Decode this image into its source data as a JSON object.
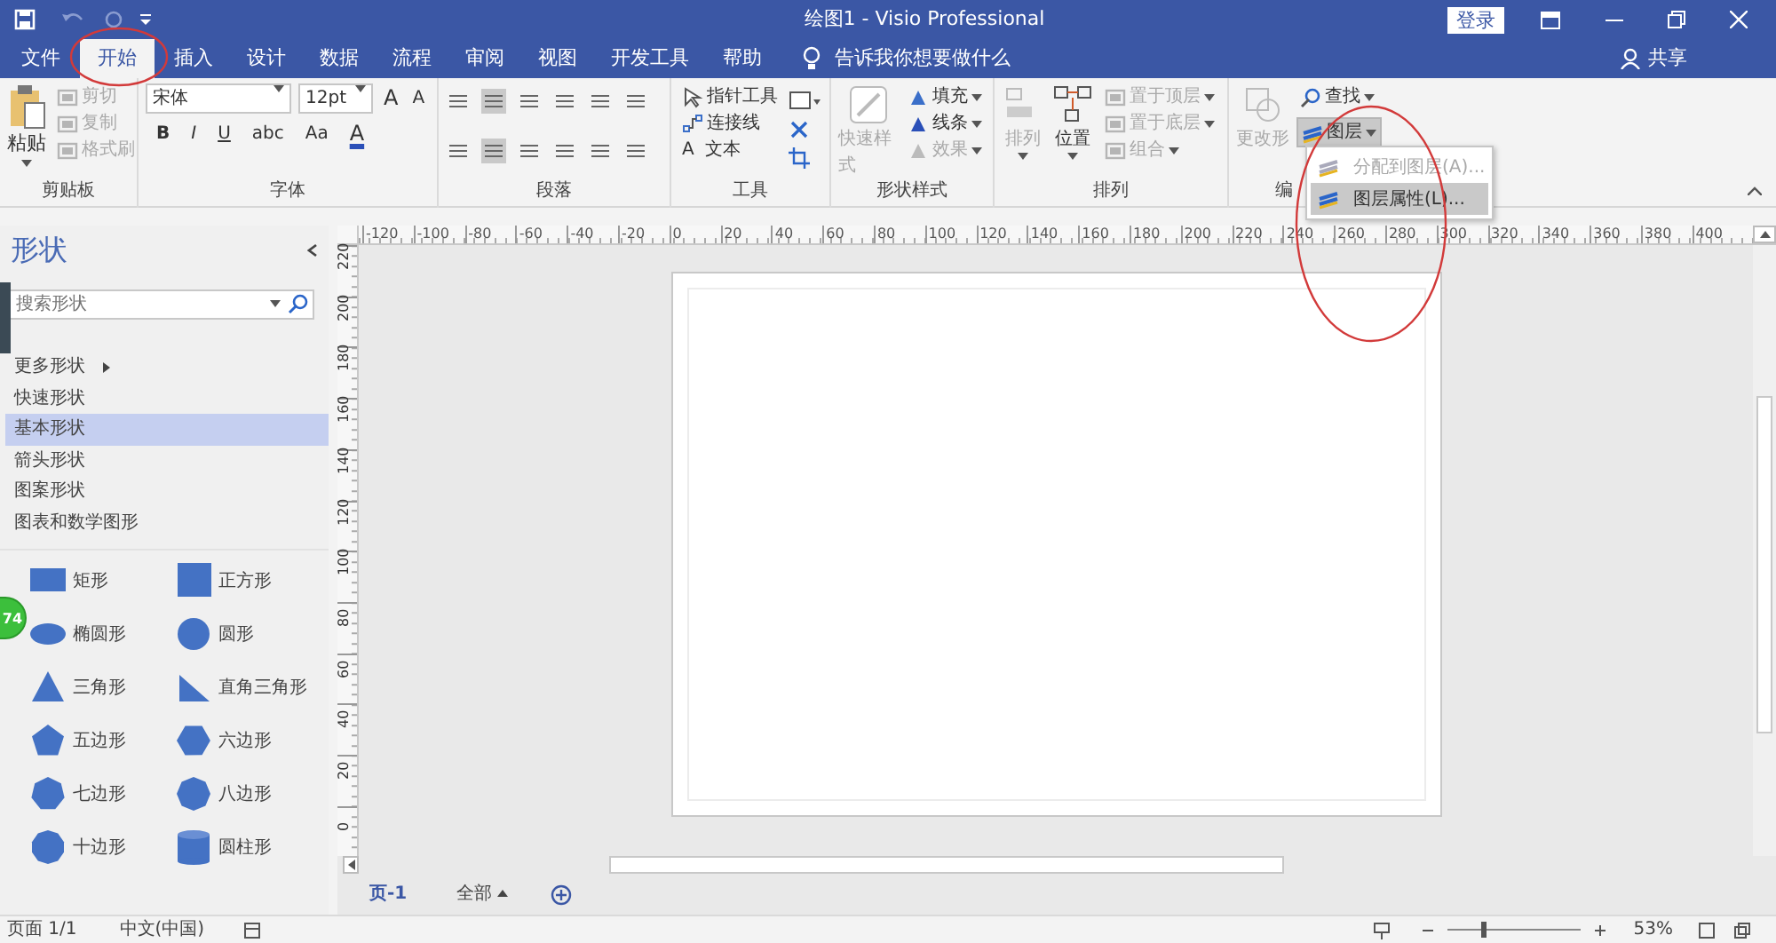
{
  "window": {
    "title": "绘图1 - Visio Professional",
    "sign_in": "登录"
  },
  "menu_tabs": [
    {
      "label": "文件",
      "selected": false
    },
    {
      "label": "开始",
      "selected": true
    },
    {
      "label": "插入",
      "selected": false
    },
    {
      "label": "设计",
      "selected": false
    },
    {
      "label": "数据",
      "selected": false
    },
    {
      "label": "流程",
      "selected": false
    },
    {
      "label": "审阅",
      "selected": false
    },
    {
      "label": "视图",
      "selected": false
    },
    {
      "label": "开发工具",
      "selected": false
    },
    {
      "label": "帮助",
      "selected": false
    }
  ],
  "tell_me": "告诉我你想要做什么",
  "share": "共享",
  "ribbon": {
    "groups": [
      {
        "kind": "clipboard",
        "label": "剪贴板",
        "items": [
          {
            "label": "粘贴",
            "disabled": false
          },
          {
            "label": "剪切",
            "disabled": true
          },
          {
            "label": "复制",
            "disabled": true
          },
          {
            "label": "格式刷",
            "disabled": true
          }
        ]
      },
      {
        "kind": "font",
        "label": "字体",
        "font": "宋体",
        "size": "12pt",
        "size_buttons": [
          "A",
          "A"
        ],
        "format_buttons": [
          "B",
          "I",
          "U",
          "abc",
          "Aa"
        ],
        "color_button": "A"
      },
      {
        "kind": "paragraph",
        "label": "段落"
      },
      {
        "kind": "tools",
        "label": "工具",
        "items": [
          {
            "label": "指针工具"
          },
          {
            "label": "连接线"
          },
          {
            "label": "文本",
            "glyph": "A"
          }
        ]
      },
      {
        "kind": "styles",
        "label": "形状样式",
        "items": [
          {
            "label": "快速样式",
            "disabled": true
          },
          {
            "label": "填充",
            "disabled": false
          },
          {
            "label": "线条",
            "disabled": false
          },
          {
            "label": "效果",
            "disabled": true
          }
        ]
      },
      {
        "kind": "arrange",
        "label": "排列",
        "items": [
          {
            "label": "排列",
            "disabled": true
          },
          {
            "label": "位置",
            "disabled": false
          },
          {
            "label": "置于顶层",
            "disabled": true
          },
          {
            "label": "置于底层",
            "disabled": true
          },
          {
            "label": "组合",
            "disabled": true
          }
        ]
      },
      {
        "kind": "editing",
        "label": "编",
        "items": [
          {
            "label": "更改形",
            "disabled": true,
            "selected": false
          },
          {
            "label": "查找",
            "disabled": false,
            "selected": false
          },
          {
            "label": "图层",
            "disabled": false,
            "selected": true
          }
        ]
      }
    ]
  },
  "dropdown": [
    {
      "label": "分配到图层(A)...",
      "disabled": true,
      "selected": false
    },
    {
      "label": "图层属性(L)...",
      "disabled": false,
      "selected": true
    }
  ],
  "shapes_panel": {
    "title": "形状",
    "search": {
      "placeholder": "搜索形状"
    },
    "categories": [
      {
        "label": "更多形状",
        "selected": false,
        "has_submenu": true
      },
      {
        "label": "快速形状",
        "selected": false,
        "has_submenu": false
      },
      {
        "label": "基本形状",
        "selected": true,
        "has_submenu": false
      },
      {
        "label": "箭头形状",
        "selected": false,
        "has_submenu": false
      },
      {
        "label": "图案形状",
        "selected": false,
        "has_submenu": false
      },
      {
        "label": "图表和数学图形",
        "selected": false,
        "has_submenu": false
      }
    ],
    "shapes": [
      {
        "kind": "rectangle",
        "label": "矩形"
      },
      {
        "kind": "square",
        "label": "正方形"
      },
      {
        "kind": "ellipse",
        "label": "椭圆形"
      },
      {
        "kind": "circle",
        "label": "圆形"
      },
      {
        "kind": "triangle",
        "label": "三角形"
      },
      {
        "kind": "right-triangle",
        "label": "直角三角形"
      },
      {
        "kind": "pentagon",
        "label": "五边形"
      },
      {
        "kind": "hexagon",
        "label": "六边形"
      },
      {
        "kind": "heptagon",
        "label": "七边形"
      },
      {
        "kind": "octagon",
        "label": "八边形"
      },
      {
        "kind": "decagon",
        "label": "十边形"
      },
      {
        "kind": "cylinder",
        "label": "圆柱形"
      }
    ]
  },
  "side_badge": "74",
  "rulers": {
    "horizontal": [
      "-120",
      "-100",
      "-80",
      "-60",
      "-40",
      "-20",
      "0",
      "20",
      "40",
      "60",
      "80",
      "100",
      "120",
      "140",
      "160",
      "180",
      "200",
      "220",
      "240",
      "260",
      "280",
      "300",
      "320",
      "340",
      "360",
      "380",
      "400"
    ],
    "vertical": [
      "220",
      "200",
      "180",
      "160",
      "140",
      "120",
      "100",
      "80",
      "60",
      "40",
      "20",
      "0"
    ]
  },
  "page_tabs": [
    {
      "label": "页-1",
      "selected": true,
      "kind": "page"
    },
    {
      "label": "全部",
      "selected": false,
      "kind": "all"
    }
  ],
  "status_bar": {
    "page": "页面 1/1",
    "language": "中文(中国)",
    "zoom_slider": {
      "level": 0.25
    },
    "zoom": "53%"
  }
}
